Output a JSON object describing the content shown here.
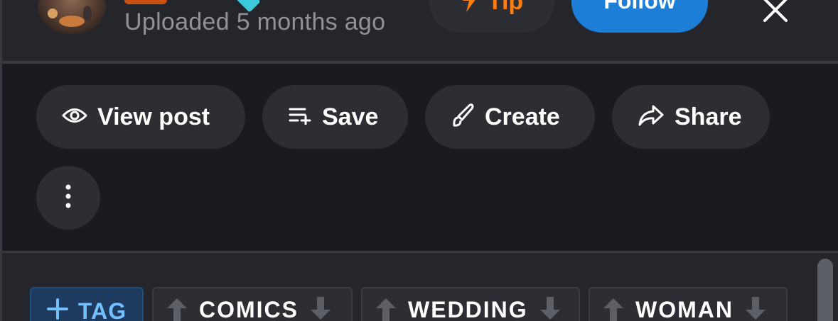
{
  "header": {
    "upload_time": "Uploaded 5 months ago",
    "tip_label": "Tip",
    "follow_label": "Follow"
  },
  "actions": {
    "view_post_label": "View post",
    "save_label": "Save",
    "create_label": "Create",
    "share_label": "Share"
  },
  "tags": {
    "add_label": "TAG",
    "items": [
      {
        "label": "COMICS"
      },
      {
        "label": "WEDDING"
      },
      {
        "label": "WOMAN"
      }
    ]
  },
  "colors": {
    "accent_blue": "#1c7ed6",
    "tip_orange": "#fd7e14",
    "tag_blue": "#74c0fc",
    "pill_bg": "#2c2e33",
    "page_bg": "#1a1b1e"
  },
  "icons": [
    "avatar",
    "lightning-icon",
    "close-icon",
    "eye-icon",
    "playlist-add-icon",
    "brush-icon",
    "share-arrow-icon",
    "dots-vertical-icon",
    "plus-icon",
    "arrow-up-icon",
    "arrow-down-icon"
  ]
}
